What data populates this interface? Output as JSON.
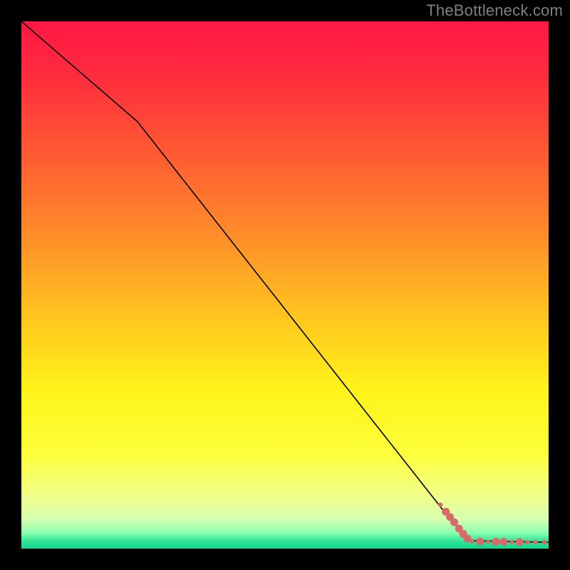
{
  "attribution": "TheBottleneck.com",
  "chart_data": {
    "type": "line",
    "title": "",
    "xlabel": "",
    "ylabel": "",
    "xlim": [
      0,
      100
    ],
    "ylim": [
      0,
      100
    ],
    "gradient_stops": [
      {
        "offset": 0.0,
        "color": "#ff1744"
      },
      {
        "offset": 0.1,
        "color": "#ff2b3e"
      },
      {
        "offset": 0.25,
        "color": "#ff5a33"
      },
      {
        "offset": 0.4,
        "color": "#ff8a2a"
      },
      {
        "offset": 0.55,
        "color": "#ffc21f"
      },
      {
        "offset": 0.7,
        "color": "#fff31a"
      },
      {
        "offset": 0.82,
        "color": "#fdff3a"
      },
      {
        "offset": 0.9,
        "color": "#f1ff8a"
      },
      {
        "offset": 0.945,
        "color": "#d6ffb0"
      },
      {
        "offset": 0.97,
        "color": "#8affb0"
      },
      {
        "offset": 0.985,
        "color": "#35e696"
      },
      {
        "offset": 1.0,
        "color": "#12d48a"
      }
    ],
    "line": {
      "color": "#000000",
      "width": 1.6,
      "points": [
        {
          "x": 0.0,
          "y": 100.0
        },
        {
          "x": 22.0,
          "y": 81.0
        },
        {
          "x": 81.0,
          "y": 6.0
        },
        {
          "x": 85.0,
          "y": 1.5
        },
        {
          "x": 100.0,
          "y": 1.2
        }
      ]
    },
    "markers": {
      "color": "#d86a6a",
      "radius_small": 3.2,
      "radius_large": 5.5,
      "points": [
        {
          "x": 79.5,
          "y": 8.3,
          "r": "small"
        },
        {
          "x": 80.5,
          "y": 7.0,
          "r": "large"
        },
        {
          "x": 81.3,
          "y": 6.0,
          "r": "large"
        },
        {
          "x": 82.1,
          "y": 5.0,
          "r": "large"
        },
        {
          "x": 83.0,
          "y": 3.8,
          "r": "large"
        },
        {
          "x": 83.8,
          "y": 2.8,
          "r": "large"
        },
        {
          "x": 84.6,
          "y": 1.9,
          "r": "large"
        },
        {
          "x": 85.5,
          "y": 1.4,
          "r": "small"
        },
        {
          "x": 87.0,
          "y": 1.35,
          "r": "large"
        },
        {
          "x": 88.5,
          "y": 1.3,
          "r": "small"
        },
        {
          "x": 90.0,
          "y": 1.3,
          "r": "large"
        },
        {
          "x": 91.5,
          "y": 1.3,
          "r": "large"
        },
        {
          "x": 93.0,
          "y": 1.25,
          "r": "small"
        },
        {
          "x": 94.5,
          "y": 1.25,
          "r": "large"
        },
        {
          "x": 96.0,
          "y": 1.2,
          "r": "small"
        },
        {
          "x": 97.5,
          "y": 1.2,
          "r": "small"
        },
        {
          "x": 99.2,
          "y": 1.2,
          "r": "small"
        }
      ]
    }
  }
}
